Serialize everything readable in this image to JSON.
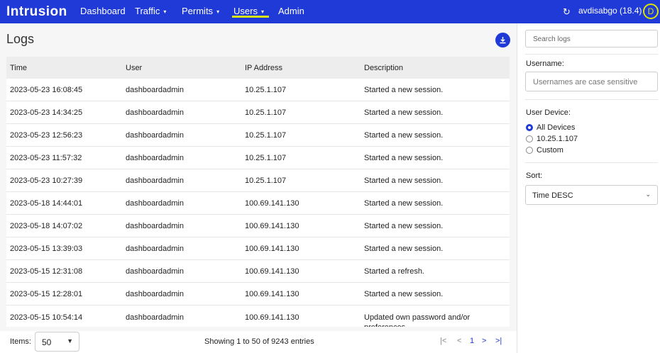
{
  "nav": {
    "logo": "Intrusion",
    "items": [
      {
        "label": "Dashboard"
      },
      {
        "label": "Traffic",
        "caret": "▾"
      },
      {
        "label": "Permits",
        "caret": "▾"
      },
      {
        "label": "Users",
        "caret": "▾"
      },
      {
        "label": "Admin"
      }
    ],
    "account": "avdisabgo (18.4)",
    "avatar_initial": "D",
    "accent": "#d9e400",
    "bg": "#1f3ad6"
  },
  "page": {
    "title": "Logs",
    "download_icon": "download-icon"
  },
  "table": {
    "headers": [
      "Time",
      "User",
      "IP Address",
      "Description"
    ],
    "rows": [
      [
        "2023-05-23 16:08:45",
        "dashboardadmin",
        "10.25.1.107",
        "Started a new session."
      ],
      [
        "2023-05-23 14:34:25",
        "dashboardadmin",
        "10.25.1.107",
        "Started a new session."
      ],
      [
        "2023-05-23 12:56:23",
        "dashboardadmin",
        "10.25.1.107",
        "Started a new session."
      ],
      [
        "2023-05-23 11:57:32",
        "dashboardadmin",
        "10.25.1.107",
        "Started a new session."
      ],
      [
        "2023-05-23 10:27:39",
        "dashboardadmin",
        "10.25.1.107",
        "Started a new session."
      ],
      [
        "2023-05-18 14:44:01",
        "dashboardadmin",
        "100.69.141.130",
        "Started a new session."
      ],
      [
        "2023-05-18 14:07:02",
        "dashboardadmin",
        "100.69.141.130",
        "Started a new session."
      ],
      [
        "2023-05-15 13:39:03",
        "dashboardadmin",
        "100.69.141.130",
        "Started a new session."
      ],
      [
        "2023-05-15 12:31:08",
        "dashboardadmin",
        "100.69.141.130",
        "Started a refresh."
      ],
      [
        "2023-05-15 12:28:01",
        "dashboardadmin",
        "100.69.141.130",
        "Started a new session."
      ],
      [
        "2023-05-15 10:54:14",
        "dashboardadmin",
        "100.69.141.130",
        "Updated own password and/or preferences."
      ]
    ]
  },
  "footer": {
    "items_label": "Items:",
    "items_value": "50",
    "showing": "Showing 1 to 50 of 9243 entries",
    "current_page": "1"
  },
  "sidebar": {
    "search_placeholder": "Search logs",
    "username_label": "Username:",
    "username_placeholder": "Usernames are case sensitive",
    "device_label": "User Device:",
    "devices": [
      {
        "label": "All Devices",
        "selected": true
      },
      {
        "label": "10.25.1.107",
        "selected": false
      },
      {
        "label": "Custom",
        "selected": false
      }
    ],
    "sort_label": "Sort:",
    "sort_value": "Time DESC"
  }
}
